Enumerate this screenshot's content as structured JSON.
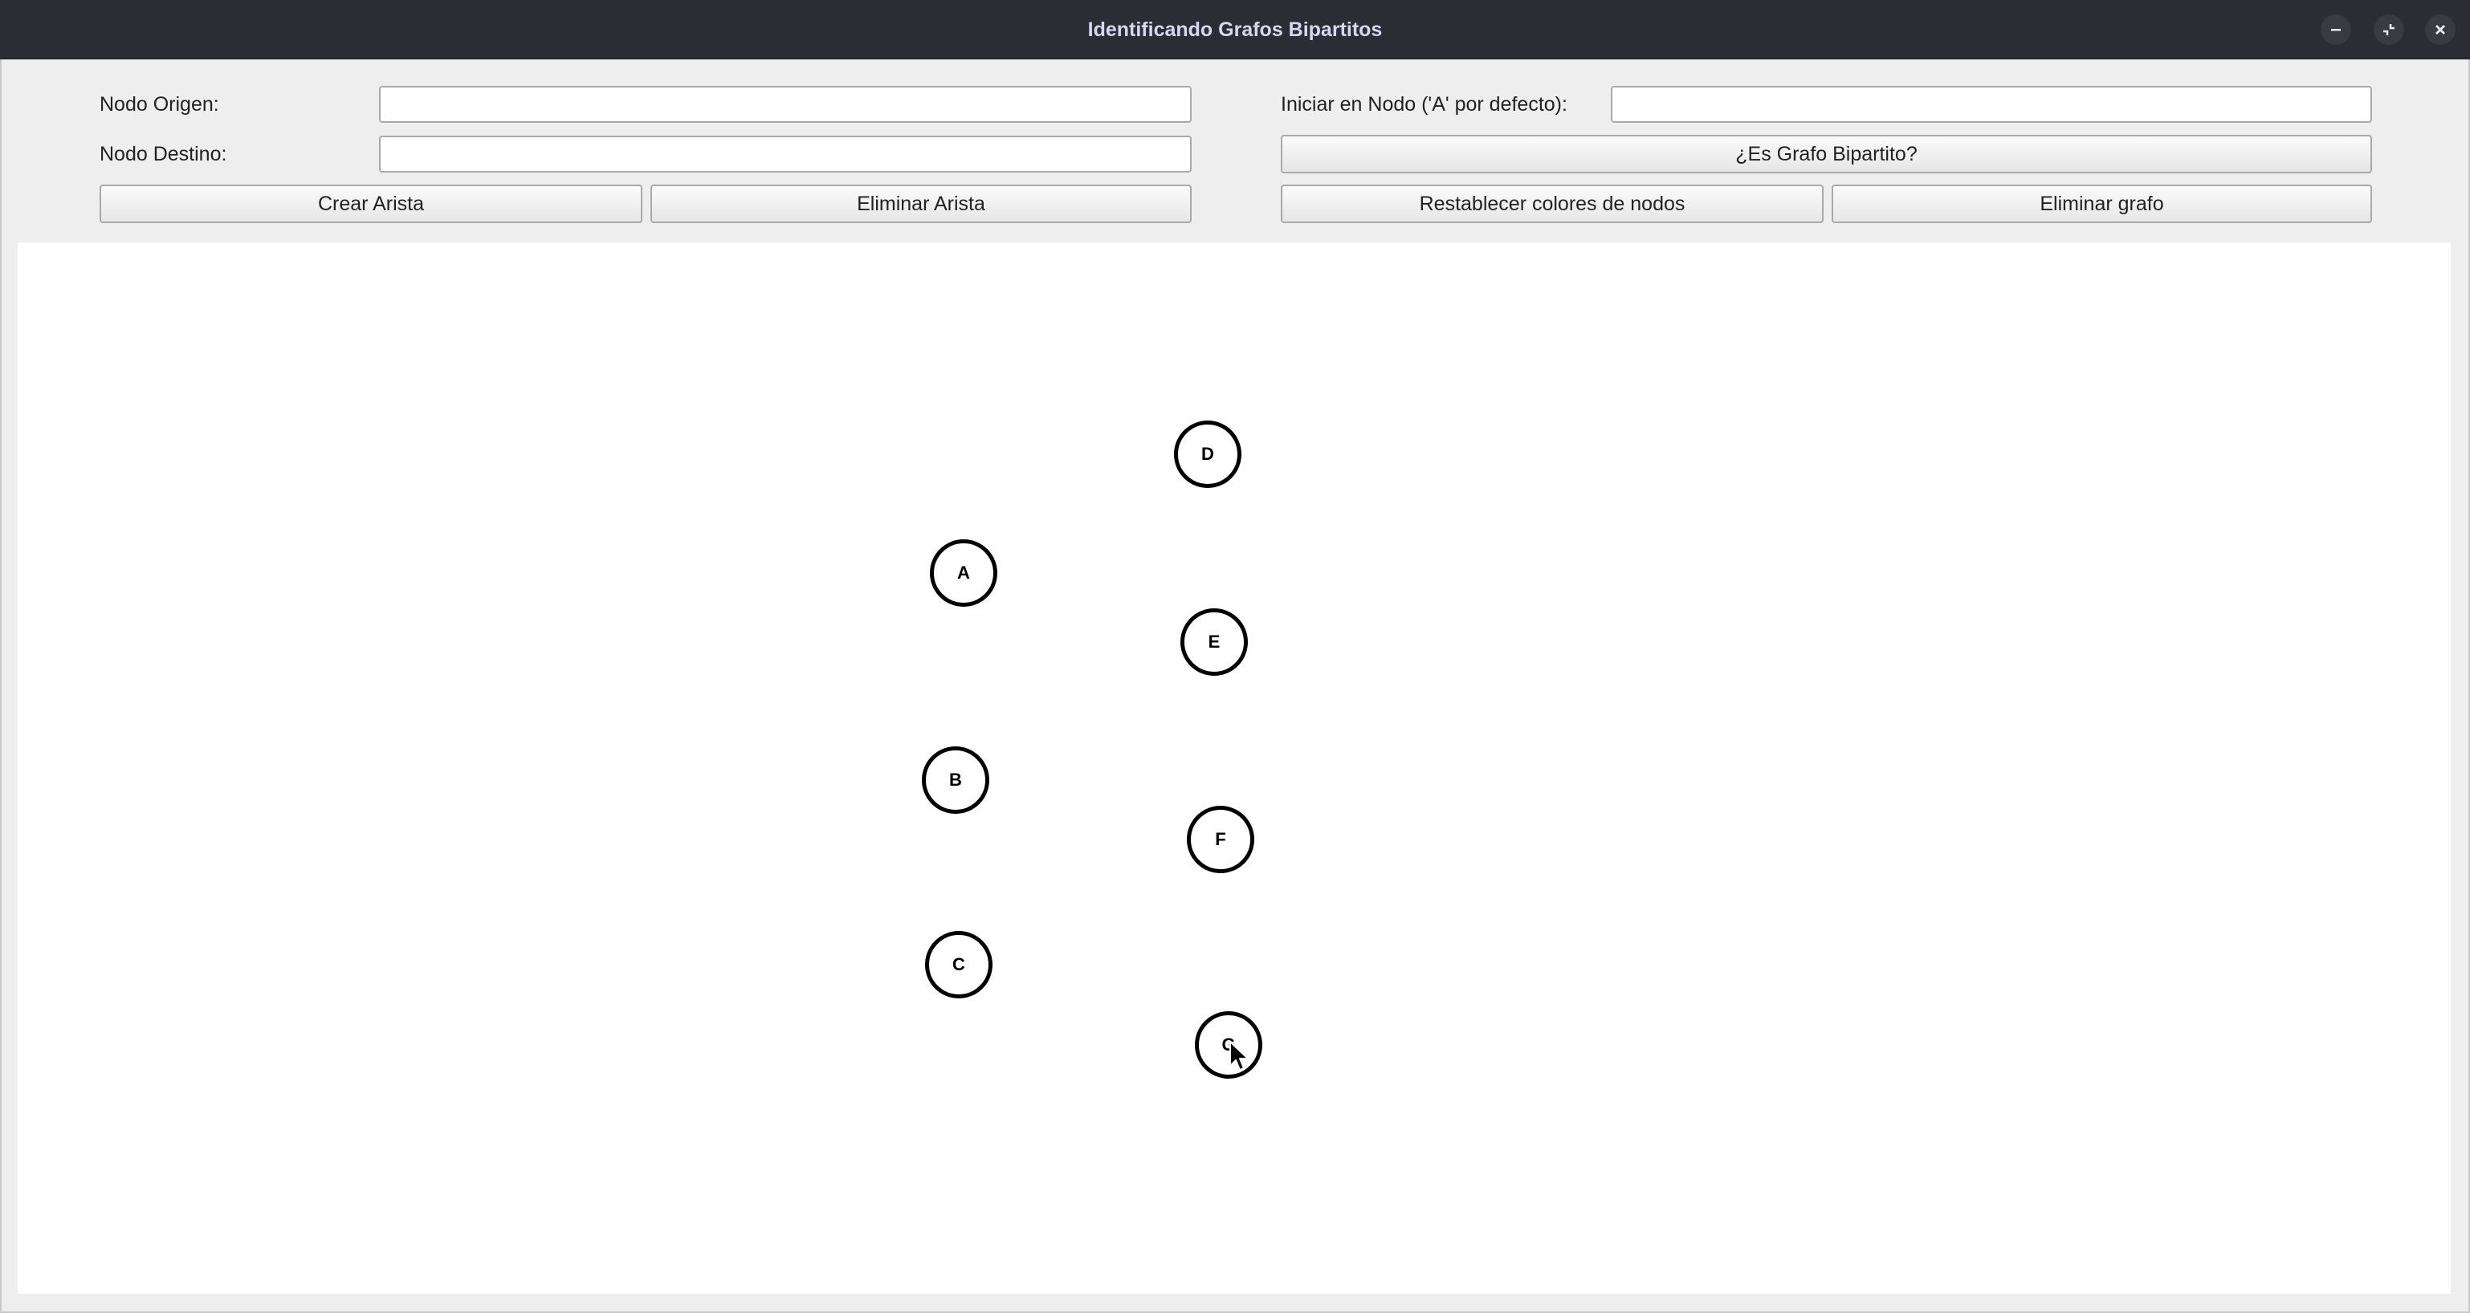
{
  "window": {
    "title": "Identificando Grafos Bipartitos",
    "controls": [
      "minimize-icon",
      "restore-icon",
      "close-icon"
    ]
  },
  "form": {
    "origin_label": "Nodo Origen:",
    "origin_value": "",
    "dest_label": "Nodo Destino:",
    "dest_value": "",
    "start_label": "Iniciar en Nodo ('A' por defecto):",
    "start_value": "",
    "create_edge": "Crear Arista",
    "delete_edge": "Eliminar Arista",
    "check_bipartite": "¿Es Grafo Bipartito?",
    "reset_colors": "Restablecer colores de nodos",
    "delete_graph": "Eliminar grafo"
  },
  "graph": {
    "nodes": [
      "D",
      "A",
      "E",
      "B",
      "F",
      "C",
      "G"
    ]
  }
}
